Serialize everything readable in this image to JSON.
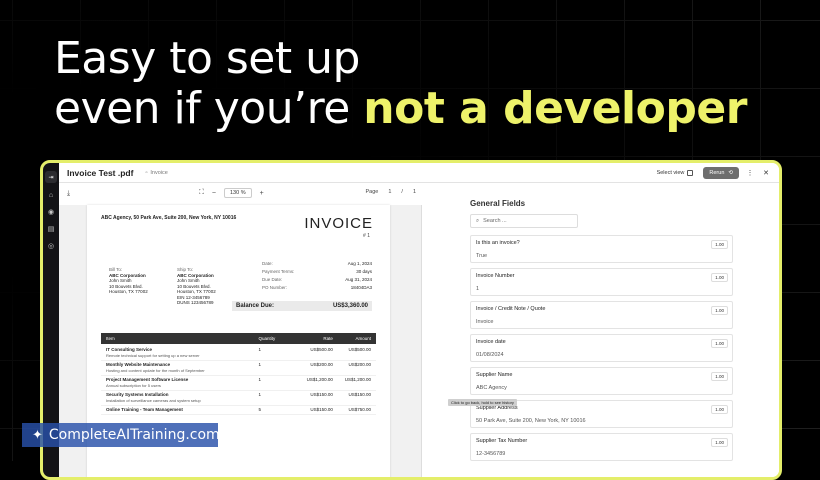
{
  "headline": {
    "line1": "Easy to set up",
    "line2_start": "even if you’re ",
    "line2_highlight": "not a developer"
  },
  "rail": {
    "icons": [
      "⇥",
      "⌂",
      "◉",
      "▤",
      "◎"
    ]
  },
  "topbar": {
    "title": "Invoice Test .pdf",
    "tag": "Invoice",
    "select_view": "Select view",
    "rerun": "Rerun"
  },
  "pdf_toolbar": {
    "zoom": "130",
    "zoom_unit": "%",
    "page_label": "Page",
    "page_current": "1",
    "page_sep": "/",
    "page_total": "1"
  },
  "invoice": {
    "from_address": "ABC Agency, 50 Park Ave, Suite 200, New York, NY 10016",
    "title": "INVOICE",
    "number": "# 1",
    "bill_to": {
      "heading": "Bill To:",
      "lines": [
        "ABC Corporation",
        "John Smith",
        "10 Bouvets Blvd.",
        "Houston, TX 77002"
      ]
    },
    "ship_to": {
      "heading": "Ship To:",
      "lines": [
        "ABC Corporation",
        "John Smith",
        "10 Bouvets Blvd.",
        "Houston, TX 77002",
        "EIN 12-3456789",
        "DUNS 123456789"
      ]
    },
    "meta": [
      {
        "k": "Date:",
        "v": "Aug 1, 2024"
      },
      {
        "k": "Payment Terms:",
        "v": "30 days"
      },
      {
        "k": "Due Date:",
        "v": "Aug 31, 2024"
      },
      {
        "k": "PO Number:",
        "v": "18404DA3"
      }
    ],
    "balance_label": "Balance Due:",
    "balance_value": "US$3,360.00",
    "headers": {
      "item": "Item",
      "qty": "Quantity",
      "rate": "Rate",
      "amount": "Amount"
    },
    "items": [
      {
        "name": "IT Consulting Service",
        "desc": "Remote technical support for setting up a new server",
        "qty": "1",
        "rate": "US$500.00",
        "amount": "US$500.00"
      },
      {
        "name": "Monthly Website Maintenance",
        "desc": "Hosting and content update for the month of September",
        "qty": "1",
        "rate": "US$200.00",
        "amount": "US$200.00"
      },
      {
        "name": "Project Management Software License",
        "desc": "Annual subscription for 5 users",
        "qty": "1",
        "rate": "US$1,200.00",
        "amount": "US$1,200.00"
      },
      {
        "name": "Security Systems Installation",
        "desc": "Installation of surveillance cameras and system setup",
        "qty": "1",
        "rate": "US$150.00",
        "amount": "US$150.00"
      },
      {
        "name": "Online Training - Team Management",
        "desc": "",
        "qty": "5",
        "rate": "US$150.00",
        "amount": "US$750.00"
      }
    ]
  },
  "fields_panel": {
    "heading": "General Fields",
    "search_placeholder": "Search ...",
    "fields": [
      {
        "label": "Is this an invoice?",
        "value": "True",
        "conf": "1.00"
      },
      {
        "label": "Invoice Number",
        "value": "1",
        "conf": "1.00"
      },
      {
        "label": "Invoice / Credit Note / Quote",
        "value": "Invoice",
        "conf": "1.00"
      },
      {
        "label": "Invoice date",
        "value": "01/08/2024",
        "conf": "1.00"
      },
      {
        "label": "Supplier Name",
        "value": "ABC Agency",
        "conf": "1.00"
      },
      {
        "label": "Supplier Address",
        "value": "50 Park Ave, Suite 200, New York, NY 10016",
        "conf": "1.00"
      },
      {
        "label": "Supplier Tax Number",
        "value": "12-3456789",
        "conf": "1.00"
      }
    ]
  },
  "tooltip": "Click to go back, hold to see history",
  "watermark": "CompleteAITraining.com"
}
